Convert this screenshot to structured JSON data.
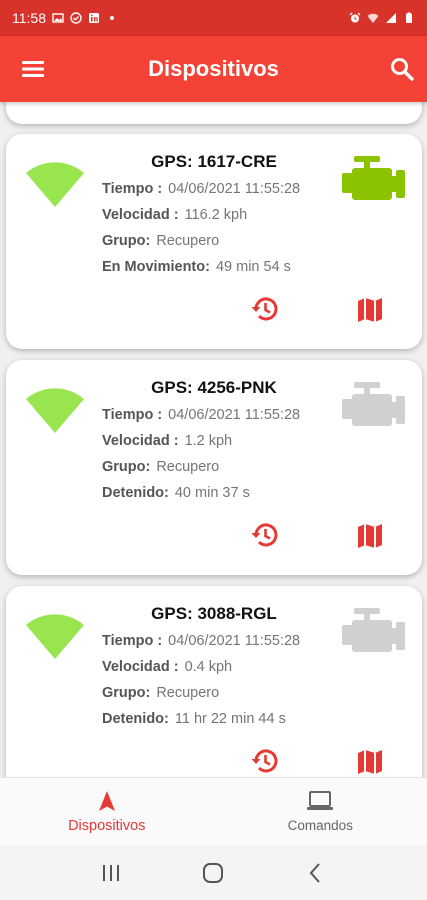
{
  "status_bar": {
    "time": "11:58"
  },
  "app_bar": {
    "title": "Dispositivos"
  },
  "devices": [
    {
      "title": "GPS: 1617-CRE",
      "engine_color": "#8bc300",
      "rows": [
        {
          "label": "Tiempo :",
          "value": "04/06/2021 11:55:28"
        },
        {
          "label": "Velocidad :",
          "value": "116.2 kph"
        },
        {
          "label": "Grupo:",
          "value": "Recupero"
        },
        {
          "label": "En Movimiento:",
          "value": "49 min 54 s"
        }
      ]
    },
    {
      "title": "GPS: 4256-PNK",
      "engine_color": "#d0d0d0",
      "rows": [
        {
          "label": "Tiempo :",
          "value": "04/06/2021 11:55:28"
        },
        {
          "label": "Velocidad :",
          "value": "1.2 kph"
        },
        {
          "label": "Grupo:",
          "value": "Recupero"
        },
        {
          "label": "Detenido:",
          "value": "40 min 37 s"
        }
      ]
    },
    {
      "title": "GPS: 3088-RGL",
      "engine_color": "#d0d0d0",
      "rows": [
        {
          "label": "Tiempo :",
          "value": "04/06/2021 11:55:28"
        },
        {
          "label": "Velocidad :",
          "value": "0.4 kph"
        },
        {
          "label": "Grupo:",
          "value": "Recupero"
        },
        {
          "label": "Detenido:",
          "value": "11 hr 22 min 44 s"
        }
      ]
    }
  ],
  "bottom_nav": {
    "dispositivos": "Dispositivos",
    "comandos": "Comandos"
  },
  "colors": {
    "accent": "#f44336",
    "signal": "#99e550",
    "action": "#e53935"
  }
}
